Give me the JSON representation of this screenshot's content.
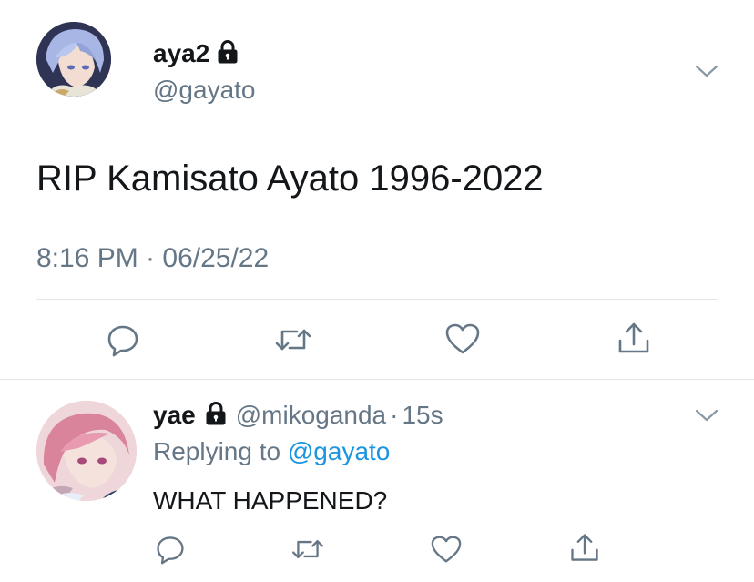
{
  "main_tweet": {
    "author": {
      "display_name": "aya2",
      "handle": "@gayato",
      "protected_icon": "lock-icon",
      "avatar_icon": "profile-avatar"
    },
    "text": "RIP Kamisato Ayato 1996-2022",
    "timestamp": "8:16 PM · 06/25/22",
    "menu_icon": "chevron-down-icon",
    "actions": [
      {
        "name": "reply-icon"
      },
      {
        "name": "retweet-icon"
      },
      {
        "name": "like-icon"
      },
      {
        "name": "share-icon"
      }
    ]
  },
  "reply_tweet": {
    "author": {
      "display_name": "yae",
      "handle": "@mikoganda",
      "protected_icon": "lock-icon",
      "avatar_icon": "profile-avatar"
    },
    "age": "15s",
    "separator": "·",
    "replying_prefix": "Replying to",
    "replying_handle": "@gayato",
    "text": "WHAT HAPPENED?",
    "menu_icon": "chevron-down-icon"
  },
  "colors": {
    "text": "#14171a",
    "muted": "#657786",
    "link": "#1b95e0",
    "divider": "#e1e8ed",
    "icon": "#657786"
  }
}
